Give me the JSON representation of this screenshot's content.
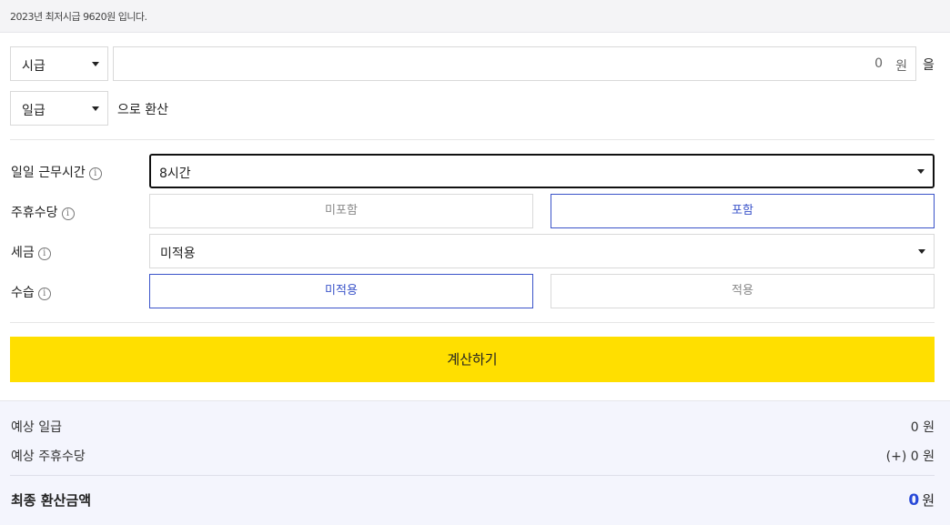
{
  "notice": {
    "text": "2023년 최저시급 9620원 입니다."
  },
  "converter": {
    "from_unit": "시급",
    "amount_value": "0",
    "amount_unit": "원",
    "object_particle": "을",
    "to_unit": "일급",
    "convert_suffix": "으로 환산"
  },
  "options": {
    "daily_hours": {
      "label": "일일 근무시간",
      "value": "8시간"
    },
    "weekly_allowance": {
      "label": "주휴수당",
      "options": [
        "미포함",
        "포함"
      ],
      "selected": "포함"
    },
    "tax": {
      "label": "세금",
      "value": "미적용"
    },
    "probation": {
      "label": "수습",
      "options": [
        "미적용",
        "적용"
      ],
      "selected": "미적용"
    },
    "info_glyph": "i"
  },
  "calculate_label": "계산하기",
  "results": {
    "expected_daily": {
      "label": "예상 일급",
      "value": "0 원"
    },
    "expected_allowance": {
      "label": "예상 주휴수당",
      "value": "(+) 0 원"
    },
    "final": {
      "label": "최종 환산금액",
      "value": "0",
      "unit": "원"
    }
  },
  "colors": {
    "accent": "#3a53c9",
    "button": "#ffdf00",
    "final_value": "#2849d8"
  }
}
